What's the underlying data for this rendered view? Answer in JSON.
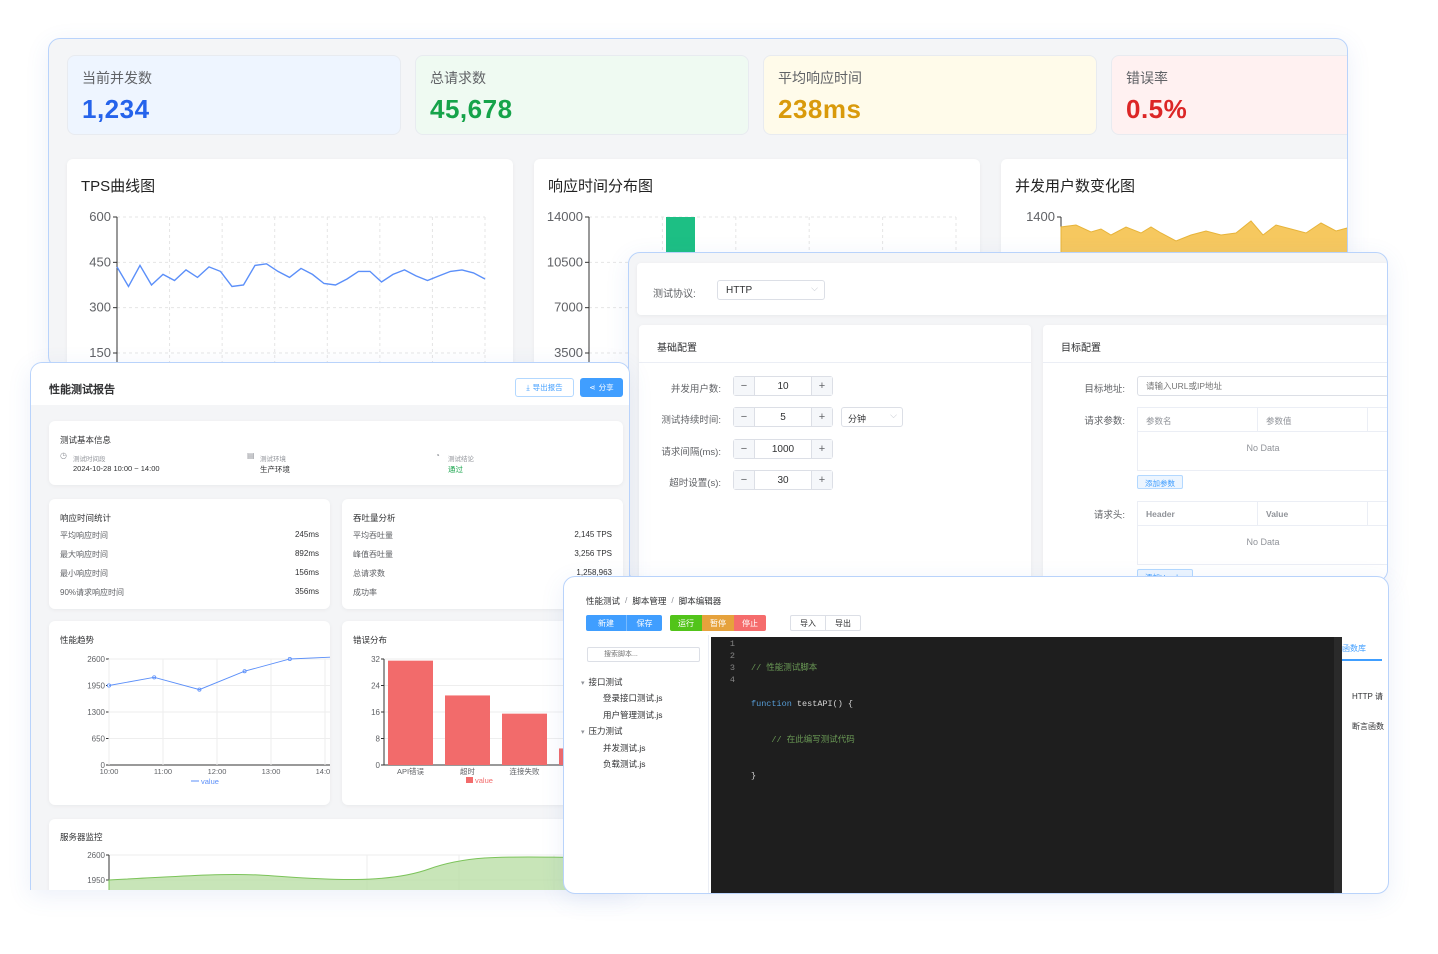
{
  "dashboard": {
    "metrics": [
      {
        "label": "当前并发数",
        "value": "1,234",
        "color": "#2563eb"
      },
      {
        "label": "总请求数",
        "value": "45,678",
        "color": "#16a34a"
      },
      {
        "label": "平均响应时间",
        "value": "238ms",
        "color": "#d99a0b"
      },
      {
        "label": "错误率",
        "value": "0.5%",
        "color": "#dc2626"
      }
    ],
    "tps_title": "TPS曲线图",
    "tps_ticks": [
      "600",
      "450",
      "300",
      "150"
    ],
    "resp_title": "响应时间分布图",
    "resp_ticks": [
      "14000",
      "10500",
      "7000",
      "3500"
    ],
    "users_title": "并发用户数变化图",
    "users_ticks": [
      "1400"
    ]
  },
  "config": {
    "protocol_label": "测试协议:",
    "protocol_value": "HTTP",
    "basic_title": "基础配置",
    "target_title": "目标配置",
    "fields": [
      {
        "label": "并发用户数:",
        "value": "10"
      },
      {
        "label": "测试持续时间:",
        "value": "5",
        "unit": "分钟"
      },
      {
        "label": "请求间隔(ms):",
        "value": "1000"
      },
      {
        "label": "超时设置(s):",
        "value": "30"
      }
    ],
    "target_label": "目标地址:",
    "target_placeholder": "请输入URL或IP地址",
    "params_label": "请求参数:",
    "params_cols": [
      "参数名",
      "参数值"
    ],
    "no_data": "No Data",
    "add_param": "添加参数",
    "headers_label": "请求头:",
    "headers_cols": [
      "Header",
      "Value"
    ],
    "add_header": "添加Header"
  },
  "report": {
    "title": "性能测试报告",
    "export": "导出报告",
    "share": "分享",
    "basic_title": "测试基本信息",
    "time_label": "测试时间段",
    "time_value": "2024-10-28 10:00 ~ 14:00",
    "env_label": "测试环境",
    "env_value": "生产环境",
    "result_label": "测试结论",
    "result_value": "通过",
    "resp_stats_title": "响应时间统计",
    "resp_stats": [
      {
        "k": "平均响应时间",
        "v": "245ms"
      },
      {
        "k": "最大响应时间",
        "v": "892ms"
      },
      {
        "k": "最小响应时间",
        "v": "156ms"
      },
      {
        "k": "90%请求响应时间",
        "v": "356ms"
      }
    ],
    "tput_title": "吞吐量分析",
    "tput_stats": [
      {
        "k": "平均吞吐量",
        "v": "2,145 TPS"
      },
      {
        "k": "峰值吞吐量",
        "v": "3,256 TPS"
      },
      {
        "k": "总请求数",
        "v": "1,258,963"
      },
      {
        "k": "成功率",
        "v": ""
      }
    ],
    "trend_title": "性能趋势",
    "error_title": "错误分布",
    "monitor_title": "服务器监控",
    "monitor_ticks": [
      "2600",
      "1950"
    ]
  },
  "editor": {
    "breadcrumb": [
      "性能测试",
      "脚本管理",
      "脚本编辑器"
    ],
    "buttons": [
      "新建",
      "保存",
      "运行",
      "暂停",
      "停止",
      "导入",
      "导出"
    ],
    "search_placeholder": "搜索脚本...",
    "tree": [
      {
        "label": "接口测试",
        "group": true
      },
      {
        "label": "登录接口测试.js",
        "group": false
      },
      {
        "label": "用户管理测试.js",
        "group": false
      },
      {
        "label": "压力测试",
        "group": true
      },
      {
        "label": "并发测试.js",
        "group": false
      },
      {
        "label": "负载测试.js",
        "group": false
      }
    ],
    "code_lines": [
      "// 性能测试脚本",
      "function testAPI() {",
      "    // 在此编写测试代码",
      "}"
    ],
    "code_line_numbers": [
      "1",
      "2",
      "3",
      "4"
    ],
    "side_tab": "函数库",
    "side_items": [
      "HTTP 请",
      "断言函数"
    ]
  },
  "chart_data": [
    {
      "type": "line",
      "title": "TPS曲线图",
      "ylim": [
        150,
        600
      ],
      "yticks": [
        600,
        450,
        300,
        150
      ],
      "values": [
        435,
        370,
        440,
        375,
        410,
        390,
        425,
        400,
        435,
        420,
        370,
        375,
        440,
        445,
        420,
        400,
        430,
        410,
        380,
        375,
        395,
        420,
        420,
        385,
        410,
        425,
        405,
        390,
        405,
        420,
        425,
        415,
        395
      ],
      "color": "#5b8ff9"
    },
    {
      "type": "bar",
      "title": "响应时间分布图",
      "ylim": [
        3500,
        14000
      ],
      "yticks": [
        14000,
        10500,
        7000,
        3500
      ],
      "values": [
        14000,
        11100
      ],
      "color": "#1dbf84"
    },
    {
      "type": "area",
      "title": "并发用户数变化图",
      "yticks": [
        1400
      ],
      "color": "#f6c85f"
    },
    {
      "type": "line",
      "title": "性能趋势",
      "x": [
        "10:00",
        "11:00",
        "12:00",
        "13:00",
        "14:00"
      ],
      "ylim": [
        0,
        2600
      ],
      "yticks": [
        2600,
        1950,
        1300,
        650,
        0
      ],
      "values": [
        1950,
        2150,
        1850,
        2300,
        2600,
        2650
      ],
      "legend": "value",
      "color": "#5b8ff9"
    },
    {
      "type": "bar",
      "title": "错误分布",
      "categories": [
        "API错误",
        "超时",
        "连接失败",
        ""
      ],
      "ylim": [
        0,
        32
      ],
      "yticks": [
        32,
        24,
        16,
        8,
        0
      ],
      "values": [
        31.5,
        21,
        15.5,
        5
      ],
      "legend": "value",
      "color": "#f26b6b"
    },
    {
      "type": "area",
      "title": "服务器监控",
      "ylim": [
        1950,
        2600
      ],
      "yticks": [
        2600,
        1950
      ],
      "color": "#b5dca0"
    }
  ]
}
